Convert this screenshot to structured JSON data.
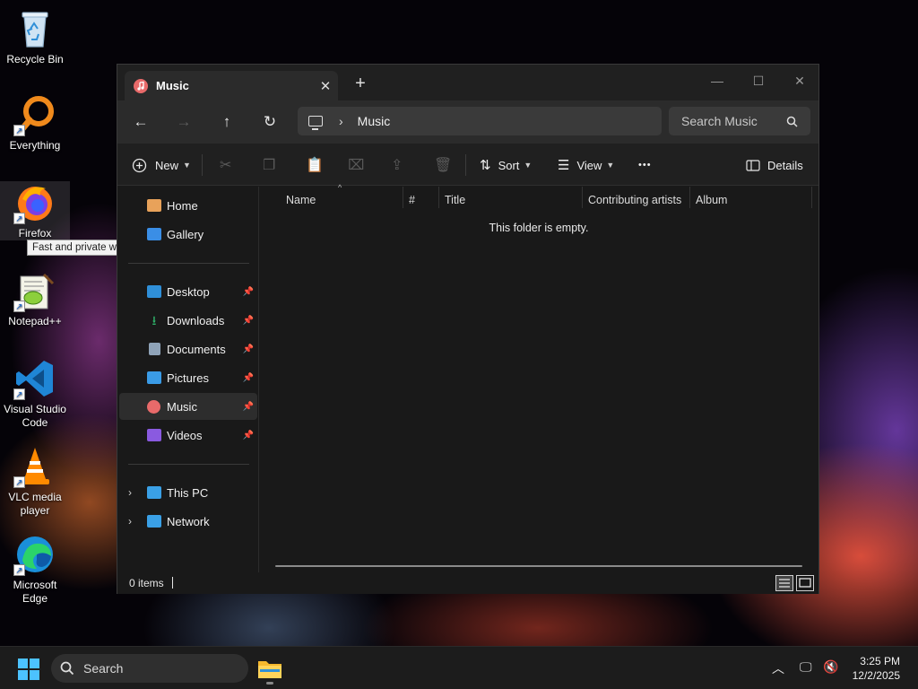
{
  "desktop": {
    "icons": [
      {
        "label": "Recycle Bin",
        "icon": "recycle-bin-icon"
      },
      {
        "label": "Everything",
        "icon": "everything-search-icon"
      },
      {
        "label": "Firefox",
        "icon": "firefox-icon"
      },
      {
        "label": "Notepad++",
        "icon": "notepad-plus-plus-icon"
      },
      {
        "label": "Visual Studio Code",
        "icon": "vscode-icon"
      },
      {
        "label": "VLC media player",
        "icon": "vlc-icon"
      },
      {
        "label": "Microsoft Edge",
        "icon": "edge-icon"
      }
    ],
    "tooltip": "Fast and private web browsing"
  },
  "explorer": {
    "tab": {
      "title": "Music",
      "icon": "music-icon"
    },
    "window_controls": {
      "minimize": "—",
      "maximize": "☐",
      "close": "✕"
    },
    "nav": {
      "back": "←",
      "forward": "→",
      "up": "↑",
      "refresh": "↻"
    },
    "address": {
      "location": "Music"
    },
    "search": {
      "placeholder": "Search Music"
    },
    "toolbar": {
      "new_label": "New",
      "sort_label": "Sort",
      "view_label": "View",
      "more_label": "•••",
      "details_label": "Details"
    },
    "sidebar": {
      "top": [
        {
          "label": "Home",
          "icon": "home-icon",
          "color": "#e8a25a"
        },
        {
          "label": "Gallery",
          "icon": "gallery-icon",
          "color": "#3a8ee6"
        }
      ],
      "pinned": [
        {
          "label": "Desktop",
          "icon": "desktop-folder-icon",
          "color": "#2f8fd8",
          "pinned": true
        },
        {
          "label": "Downloads",
          "icon": "downloads-icon",
          "color": "#2fb36a",
          "pinned": true
        },
        {
          "label": "Documents",
          "icon": "documents-icon",
          "color": "#8fa3b8",
          "pinned": true
        },
        {
          "label": "Pictures",
          "icon": "pictures-icon",
          "color": "#3a9be6",
          "pinned": true
        },
        {
          "label": "Music",
          "icon": "music-icon",
          "color": "#e86a6a",
          "pinned": true,
          "selected": true
        },
        {
          "label": "Videos",
          "icon": "videos-icon",
          "color": "#8a5ae0",
          "pinned": true
        }
      ],
      "locations": [
        {
          "label": "This PC",
          "icon": "this-pc-icon",
          "color": "#3aa0e6"
        },
        {
          "label": "Network",
          "icon": "network-icon",
          "color": "#3aa0e6"
        }
      ]
    },
    "columns": [
      "Name",
      "#",
      "Title",
      "Contributing artists",
      "Album"
    ],
    "empty_message": "This folder is empty.",
    "status": {
      "item_count": "0 items"
    }
  },
  "taskbar": {
    "search_label": "Search",
    "time": "3:25 PM",
    "date": "12/2/2025",
    "accent": "#4cc2ff"
  }
}
